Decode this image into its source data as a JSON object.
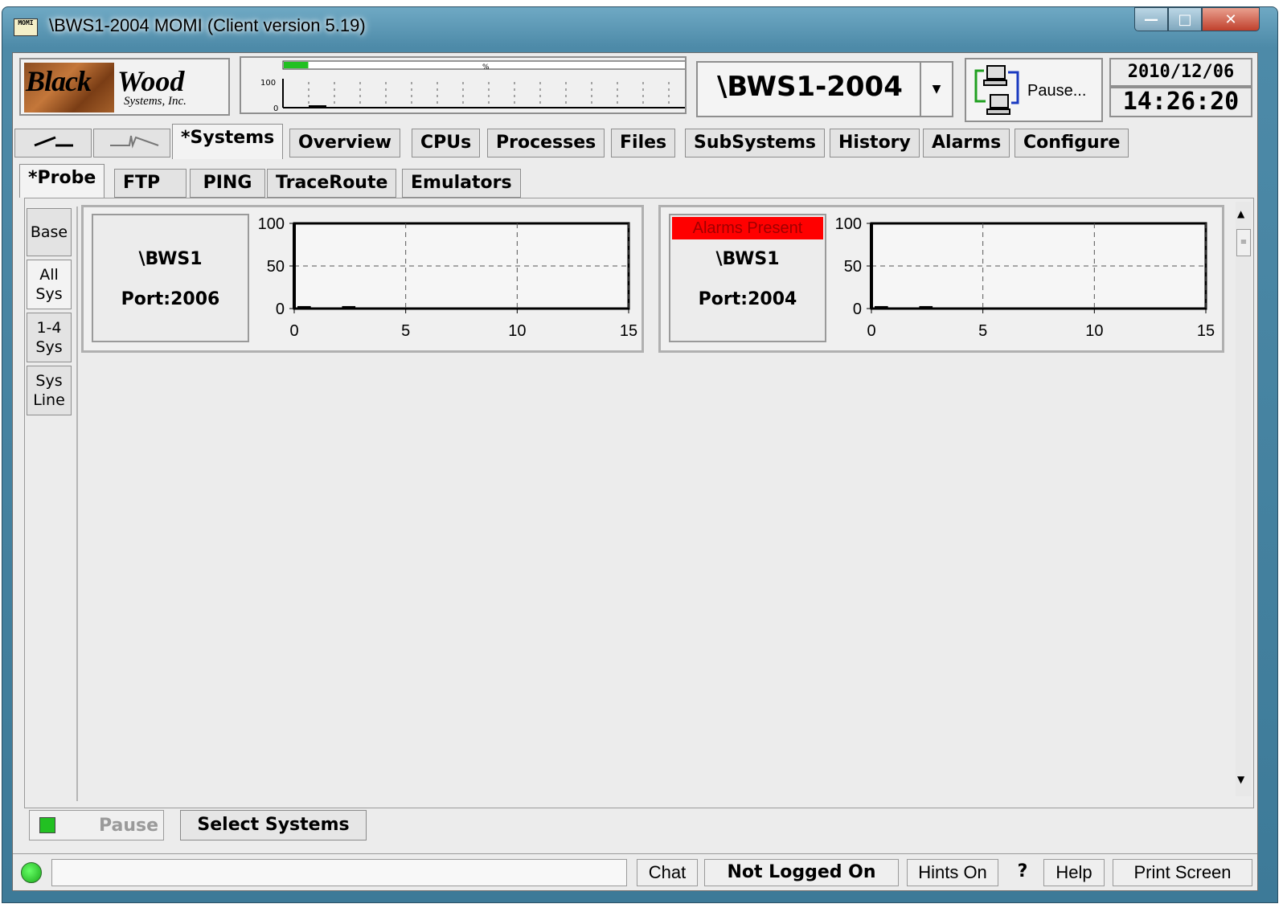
{
  "window": {
    "title": "\\BWS1-2004 MOMI (Client version 5.19)",
    "icon_text": "MOMI",
    "buttons": [
      "minimize",
      "maximize",
      "close"
    ]
  },
  "logo": {
    "word1": "Black",
    "word2": "Wood",
    "sub": "Systems, Inc."
  },
  "mini_graph": {
    "y_max_label": "100",
    "y_min_label": "0",
    "bar_label": "%",
    "progress": 0.05
  },
  "node_selector": {
    "value": "\\BWS1-2004"
  },
  "pause_control": {
    "label": "Pause..."
  },
  "clock": {
    "date": "2010/12/06",
    "time": "14:26:20"
  },
  "main_tabs": [
    {
      "label": "*Systems",
      "active": true
    },
    {
      "label": "Overview"
    },
    {
      "label": "CPUs"
    },
    {
      "label": "Processes"
    },
    {
      "label": "Files"
    },
    {
      "label": "SubSystems"
    },
    {
      "label": "History"
    },
    {
      "label": "Alarms"
    },
    {
      "label": "Configure"
    }
  ],
  "sub_tabs": [
    {
      "label": "*Probe",
      "active": true
    },
    {
      "label": "FTP"
    },
    {
      "label": "PING"
    },
    {
      "label": "TraceRoute"
    },
    {
      "label": "Emulators"
    }
  ],
  "side_tabs": [
    {
      "label": "Base"
    },
    {
      "label": "All Sys",
      "active": true
    },
    {
      "label": "1-4 Sys"
    },
    {
      "label": "Sys Line"
    }
  ],
  "systems": [
    {
      "name": "\\BWS1",
      "port": "Port:2006",
      "alarm": ""
    },
    {
      "name": "\\BWS1",
      "port": "Port:2004",
      "alarm": "Alarms Present"
    }
  ],
  "chart_data": [
    {
      "type": "bar",
      "x": [
        0,
        1,
        2
      ],
      "values": [
        1,
        0,
        1
      ],
      "xlim": [
        0,
        15
      ],
      "ylim": [
        0,
        100
      ],
      "xticks": [
        "0",
        "5",
        "10",
        "15"
      ],
      "yticks": [
        "0",
        "50",
        "100"
      ],
      "grid": true
    },
    {
      "type": "bar",
      "x": [
        0,
        1,
        2
      ],
      "values": [
        1,
        0,
        1
      ],
      "xlim": [
        0,
        15
      ],
      "ylim": [
        0,
        100
      ],
      "xticks": [
        "0",
        "5",
        "10",
        "15"
      ],
      "yticks": [
        "0",
        "50",
        "100"
      ],
      "grid": true
    }
  ],
  "bottom": {
    "pause_label": "Pause",
    "select_label": "Select Systems"
  },
  "status_bar": {
    "message": "",
    "chat": "Chat",
    "login": "Not Logged On",
    "hints": "Hints On",
    "question": "?",
    "help": "Help",
    "print": "Print Screen"
  },
  "colors": {
    "alarm": "#ff0000",
    "led": "#22c022",
    "chrome": "#4d8aa8"
  }
}
